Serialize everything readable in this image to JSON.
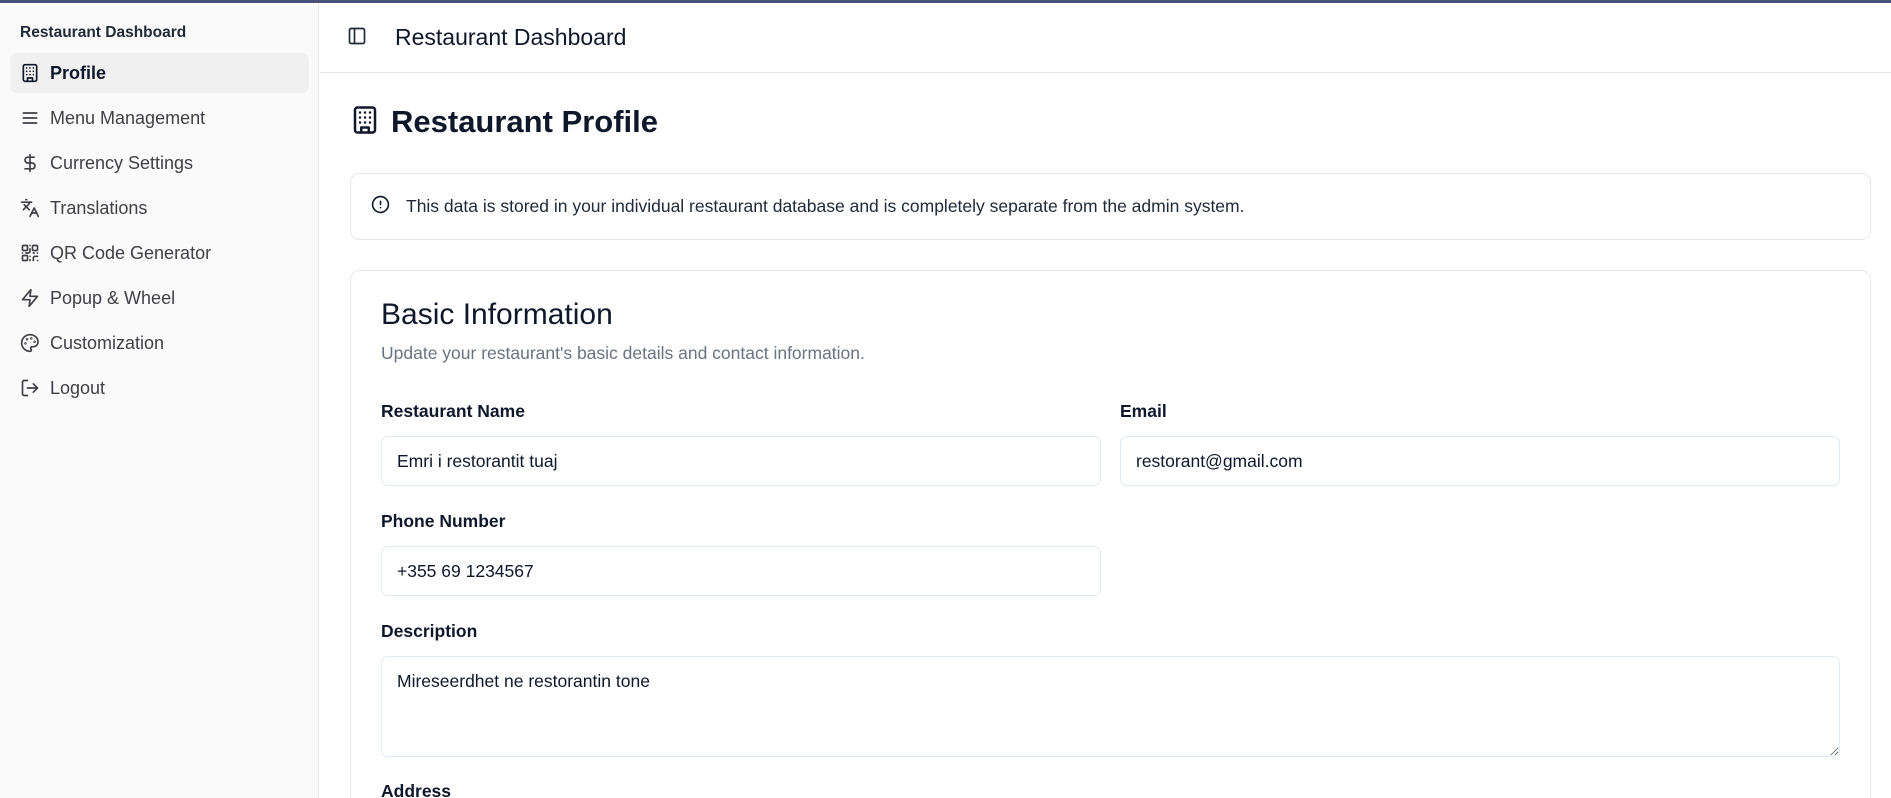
{
  "sidebar": {
    "title": "Restaurant Dashboard",
    "items": [
      {
        "label": "Profile",
        "icon": "building-icon",
        "active": true
      },
      {
        "label": "Menu Management",
        "icon": "menu-icon"
      },
      {
        "label": "Currency Settings",
        "icon": "dollar-icon"
      },
      {
        "label": "Translations",
        "icon": "languages-icon"
      },
      {
        "label": "QR Code Generator",
        "icon": "qr-code-icon"
      },
      {
        "label": "Popup & Wheel",
        "icon": "zap-icon"
      },
      {
        "label": "Customization",
        "icon": "palette-icon"
      },
      {
        "label": "Logout",
        "icon": "logout-icon"
      }
    ]
  },
  "header": {
    "title": "Restaurant Dashboard",
    "toggle_icon": "panel-left-icon"
  },
  "main": {
    "heading": "Restaurant Profile",
    "heading_icon": "building-icon",
    "alert": {
      "icon": "info-circle-icon",
      "text": "This data is stored in your individual restaurant database and is completely separate from the admin system."
    },
    "card": {
      "title": "Basic Information",
      "description": "Update your restaurant's basic details and contact information.",
      "fields": {
        "restaurant_name": {
          "label": "Restaurant Name",
          "value": "Emri i restorantit tuaj"
        },
        "email": {
          "label": "Email",
          "value": "restorant@gmail.com"
        },
        "phone": {
          "label": "Phone Number",
          "value": "+355 69 1234567"
        },
        "description": {
          "label": "Description",
          "value": "Mireseerdhet ne restorantin tone"
        },
        "address": {
          "label": "Address"
        }
      }
    }
  },
  "colors": {
    "topline": "#4b5078",
    "sidebar_bg": "#fafafa",
    "active_item_bg": "#f0f0f1",
    "muted_text": "#6b7280",
    "border": "#e5e7eb"
  }
}
